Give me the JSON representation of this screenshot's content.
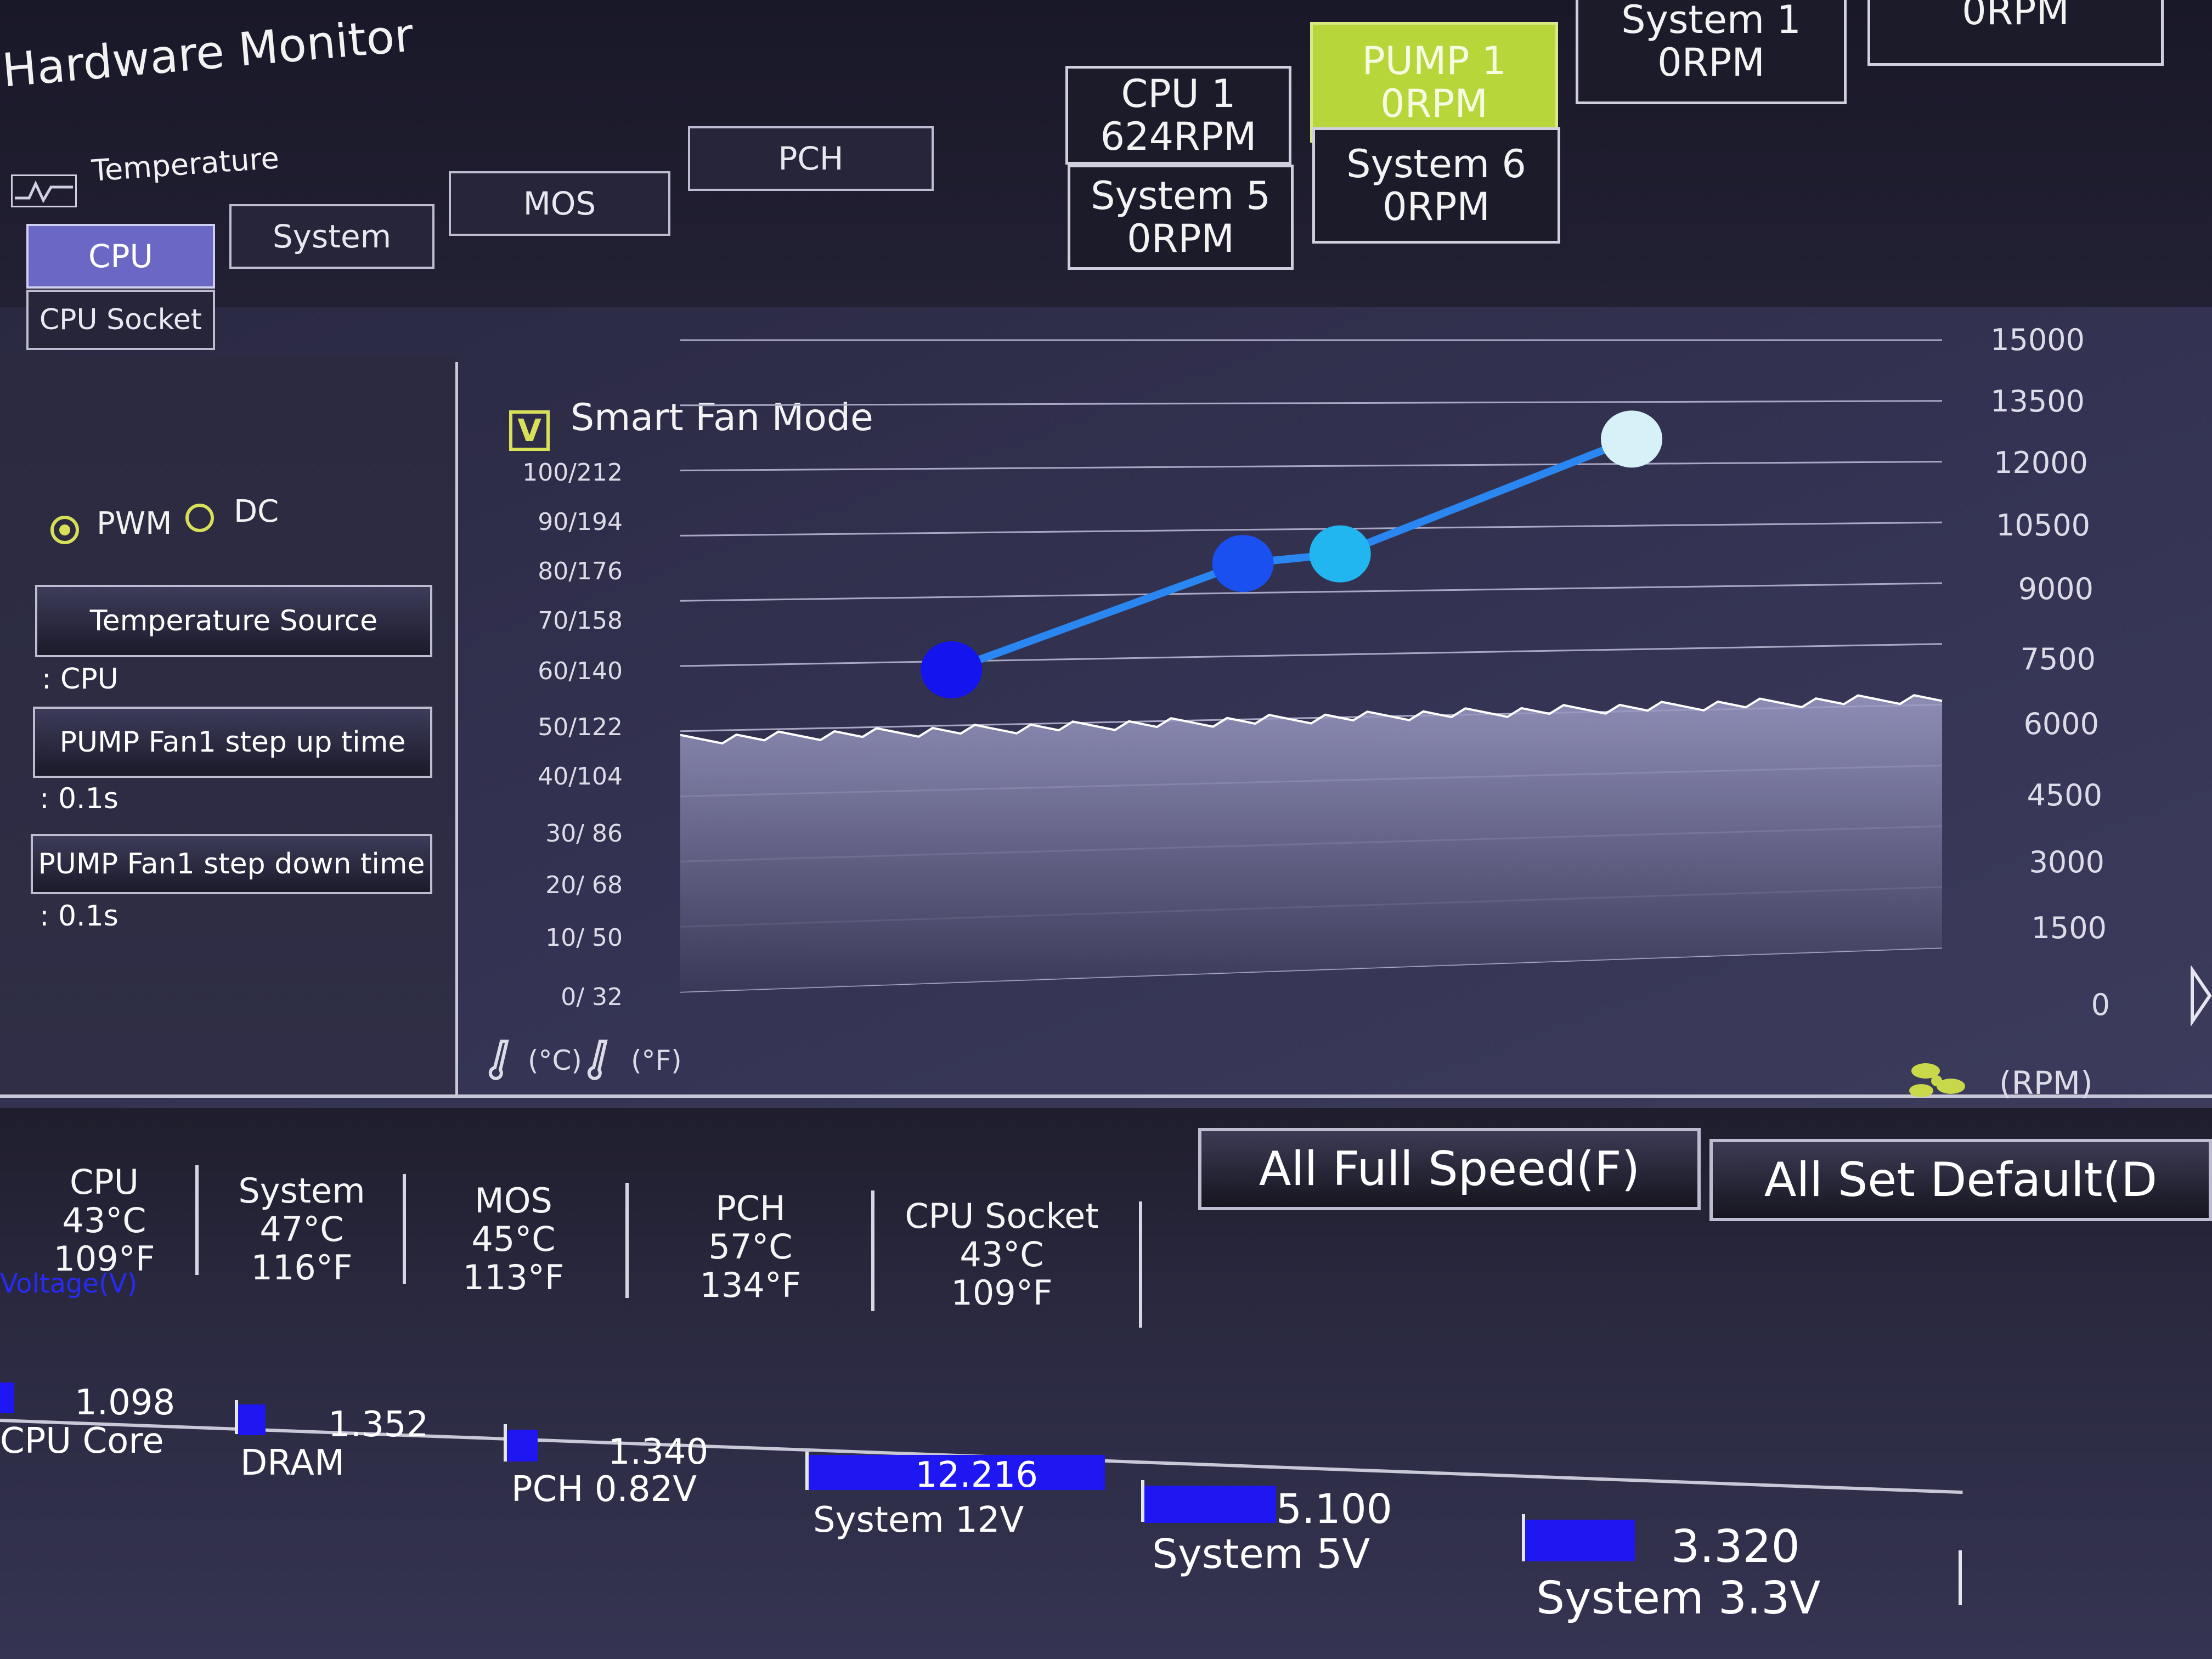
{
  "app": {
    "title": "Hardware Monitor"
  },
  "temperature": {
    "label": "Temperature",
    "tabs": [
      {
        "label": "CPU",
        "active": true
      },
      {
        "label": "System",
        "active": false
      },
      {
        "label": "MOS",
        "active": false
      },
      {
        "label": "PCH",
        "active": false
      },
      {
        "label": "CPU Socket",
        "active": false
      }
    ]
  },
  "fans": [
    {
      "name": "CPU 1",
      "rpm": "624RPM",
      "active": false
    },
    {
      "name": "PUMP 1",
      "rpm": "0RPM",
      "active": true
    },
    {
      "name": "System 1",
      "rpm": "0RPM",
      "active": false
    },
    {
      "name": "",
      "rpm": "0RPM",
      "active": false
    },
    {
      "name": "System 5",
      "rpm": "0RPM",
      "active": false
    },
    {
      "name": "System 6",
      "rpm": "0RPM",
      "active": false
    }
  ],
  "settings": {
    "pwm_label": "PWM",
    "dc_label": "DC",
    "mode_selected": "PWM",
    "temp_source_label": "Temperature Source",
    "temp_source_value": ": CPU",
    "step_up_label": "PUMP Fan1 step up time",
    "step_up_value": ": 0.1s",
    "step_down_label": "PUMP Fan1 step down time",
    "step_down_value": ": 0.1s"
  },
  "smart_fan": {
    "checkbox_mark": "V",
    "checked": true,
    "label": "Smart Fan Mode",
    "left_ticks": [
      "100/212",
      "90/194",
      "80/176",
      "70/158",
      "60/140",
      "50/122",
      "40/104",
      "30/ 86",
      "20/ 68",
      "10/ 50",
      "0/ 32"
    ],
    "right_ticks": [
      "15000",
      "13500",
      "12000",
      "10500",
      "9000",
      "7500",
      "6000",
      "4500",
      "3000",
      "1500",
      "0"
    ],
    "temp_unit_c": "(°C)",
    "temp_unit_f": "(°F)",
    "rpm_unit": "(RPM)"
  },
  "chart_data": {
    "type": "line",
    "x_label": "Temperature",
    "y_label": "RPM",
    "xlim": [
      0,
      100
    ],
    "ylim": [
      0,
      15000
    ],
    "curve_points": [
      {
        "temp_c": 60,
        "rpm_pct": 0.0,
        "rpm": 7300
      },
      {
        "temp_c": 75,
        "rpm_pct": 0.0,
        "rpm": 9700
      },
      {
        "temp_c": 80,
        "rpm_pct": 0.0,
        "rpm": 9900
      },
      {
        "temp_c": 95,
        "rpm_pct": 0.0,
        "rpm": 12600
      }
    ],
    "history_rpm_approx": 5800
  },
  "buttons": {
    "all_full_speed": "All Full Speed(F)",
    "all_set_default": "All Set Default(D"
  },
  "temps": [
    {
      "name": "CPU",
      "c": "43°C",
      "f": "109°F"
    },
    {
      "name": "System",
      "c": "47°C",
      "f": "116°F"
    },
    {
      "name": "MOS",
      "c": "45°C",
      "f": "113°F"
    },
    {
      "name": "PCH",
      "c": "57°C",
      "f": "134°F"
    },
    {
      "name": "CPU Socket",
      "c": "43°C",
      "f": "109°F"
    }
  ],
  "voltage": {
    "heading": "Voltage(V)",
    "items": [
      {
        "name": "CPU Core",
        "value": "1.098",
        "fill": 0.08
      },
      {
        "name": "DRAM",
        "value": "1.352",
        "fill": 0.1
      },
      {
        "name": "PCH 0.82V",
        "value": "1.340",
        "fill": 0.1
      },
      {
        "name": "System 12V",
        "value": "12.216",
        "fill": 1.0
      },
      {
        "name": "System 5V",
        "value": "5.100",
        "fill": 0.42
      },
      {
        "name": "System 3.3V",
        "value": "3.320",
        "fill": 0.28
      }
    ]
  }
}
